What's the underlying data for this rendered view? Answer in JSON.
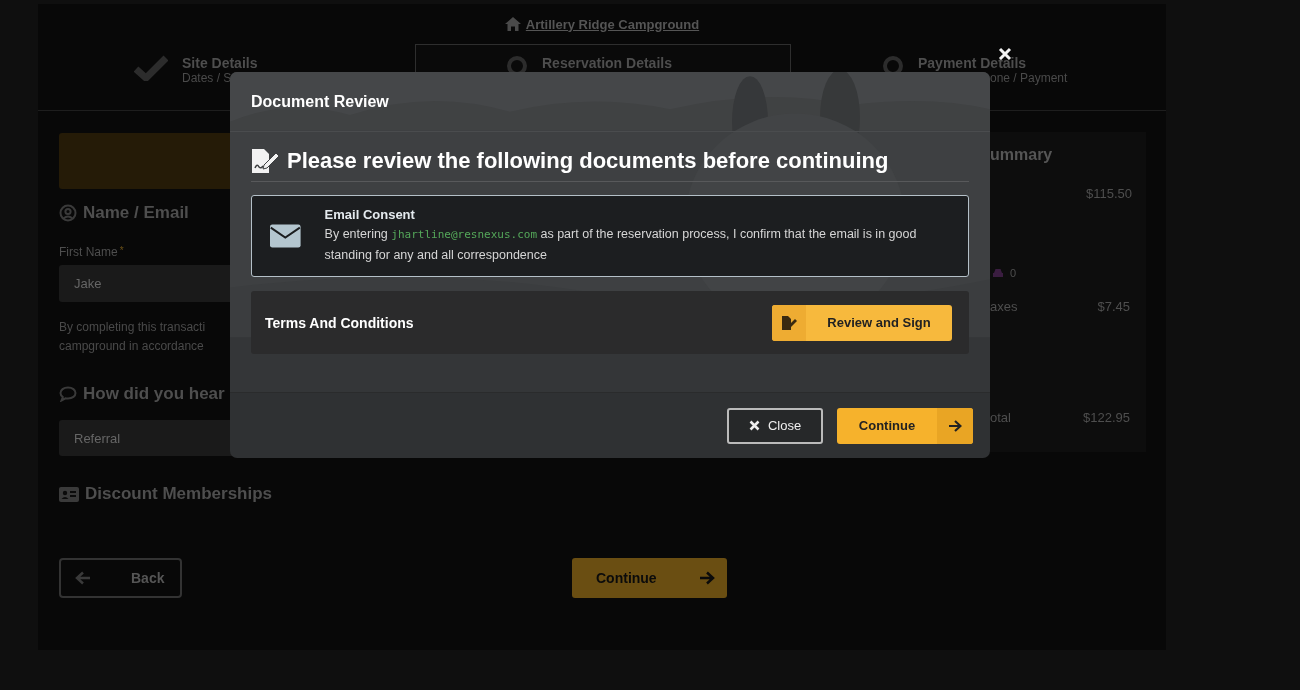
{
  "header": {
    "link": "Artillery Ridge Campground"
  },
  "steps": [
    {
      "title": "Site Details",
      "subtitle": "Dates / S",
      "kind": "done",
      "selected": false
    },
    {
      "title": "Reservation Details",
      "kind": "current",
      "selected": true
    },
    {
      "title": "Payment Details",
      "subtitle": "one / Payment",
      "kind": "pending",
      "selected": false
    }
  ],
  "form": {
    "name_heading": "Name / Email",
    "first_name_label": "First Name",
    "required_mark": "*",
    "first_name_value": "Jake",
    "notice_lines": [
      "By completing this transacti",
      "campground in accordance"
    ],
    "hear_heading": "How did you hear",
    "hear_value": "Referral",
    "discount_heading": "Discount Memberships"
  },
  "summary": {
    "title": "ummary",
    "price": "$115.50",
    "vehicles": "0",
    "taxes_label": "axes",
    "taxes": "$7.45",
    "total_label": "otal",
    "total": "$122.95"
  },
  "nav": {
    "back": "Back",
    "continue": "Continue"
  },
  "modal": {
    "title": "Document Review",
    "heading": "Please review the following documents before continuing",
    "documents": [
      {
        "kind": "consent",
        "title": "Email Consent",
        "text_before": "By entering",
        "email": "jhartline@resnexus.com",
        "text_after": "as part of the reservation process, I confirm that the email is in good standing for any and all correspondence"
      },
      {
        "kind": "sign",
        "title": "Terms And Conditions",
        "button": "Review and Sign"
      }
    ],
    "close": "Close",
    "continue": "Continue"
  }
}
